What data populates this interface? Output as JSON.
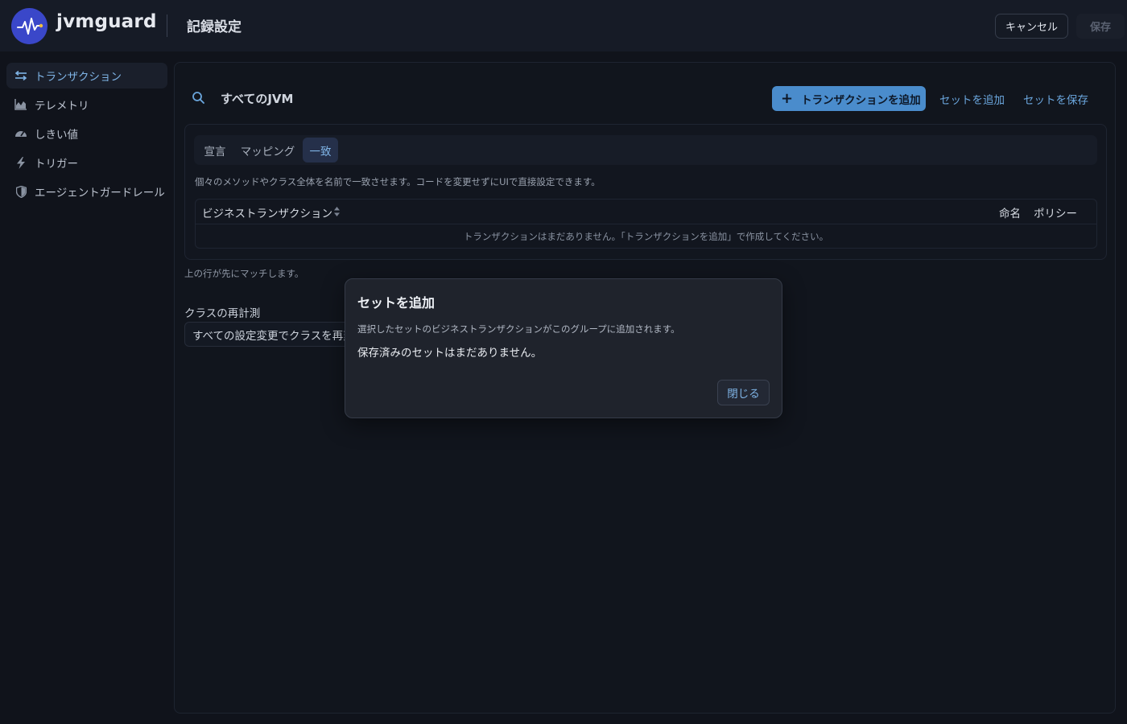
{
  "app": {
    "name": "jvmguard",
    "page_title": "記録設定"
  },
  "header": {
    "cancel_label": "キャンセル",
    "save_label": "保存"
  },
  "sidebar": {
    "items": [
      {
        "label": "トランザクション",
        "icon": "transactions-icon",
        "active": true
      },
      {
        "label": "テレメトリ",
        "icon": "chart-icon",
        "active": false
      },
      {
        "label": "しきい値",
        "icon": "gauge-icon",
        "active": false
      },
      {
        "label": "トリガー",
        "icon": "lightning-icon",
        "active": false
      },
      {
        "label": "エージェントガードレール",
        "icon": "shield-icon",
        "active": false
      }
    ]
  },
  "main": {
    "scope_label": "すべてのJVM",
    "add_transaction_label": "トランザクションを追加",
    "add_set_label": "セットを追加",
    "save_set_label": "セットを保存",
    "tabs": [
      {
        "label": "宣言",
        "active": false
      },
      {
        "label": "マッピング",
        "active": false
      },
      {
        "label": "一致",
        "active": true
      }
    ],
    "description": "個々のメソッドやクラス全体を名前で一致させます。コードを変更せずにUIで直接設定できます。",
    "table": {
      "col_business_transaction": "ビジネストランザクション",
      "col_naming": "命名",
      "col_policy": "ポリシー",
      "empty_message": "トランザクションはまだありません。「トランザクションを追加」で作成してください。"
    },
    "hint": "上の行が先にマッチします。",
    "reinstrument": {
      "label": "クラスの再計測",
      "value": "すべての設定変更でクラスを再変"
    }
  },
  "dialog": {
    "title": "セットを追加",
    "description": "選択したセットのビジネストランザクションがこのグループに追加されます。",
    "empty_message": "保存済みのセットはまだありません。",
    "close_label": "閉じる"
  },
  "colors": {
    "accent": "#4a8ccc",
    "link": "#6aa5dc",
    "background": "#10131b",
    "logo": "#3a47c9"
  }
}
